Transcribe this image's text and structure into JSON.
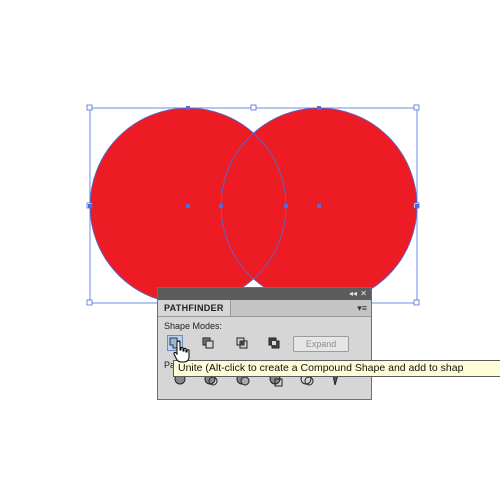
{
  "panel": {
    "tab_title": "PATHFINDER",
    "titlebar_collapse_glyph": "◂◂",
    "titlebar_close_glyph": "✕",
    "menu_glyph": "▾≡",
    "shape_modes_label": "Shape Modes:",
    "pathfinders_label": "Pa",
    "expand_label": "Expand",
    "shape_mode_icons": [
      "unite-icon",
      "minus-front-icon",
      "intersect-icon",
      "exclude-icon"
    ],
    "pathfinder_icons": [
      "divide-icon",
      "trim-icon",
      "merge-icon",
      "crop-icon",
      "outline-icon",
      "minus-back-icon"
    ]
  },
  "tooltip": {
    "text": "Unite (Alt-click to create a Compound Shape and add to shap"
  },
  "colors": {
    "shape_fill": "#ed1c24",
    "selection": "#4a6ee0",
    "panel_bg": "#d6d6d6",
    "tooltip_bg": "#fdfdd8"
  },
  "icons": {
    "cursor": "hand-pointer-icon"
  }
}
